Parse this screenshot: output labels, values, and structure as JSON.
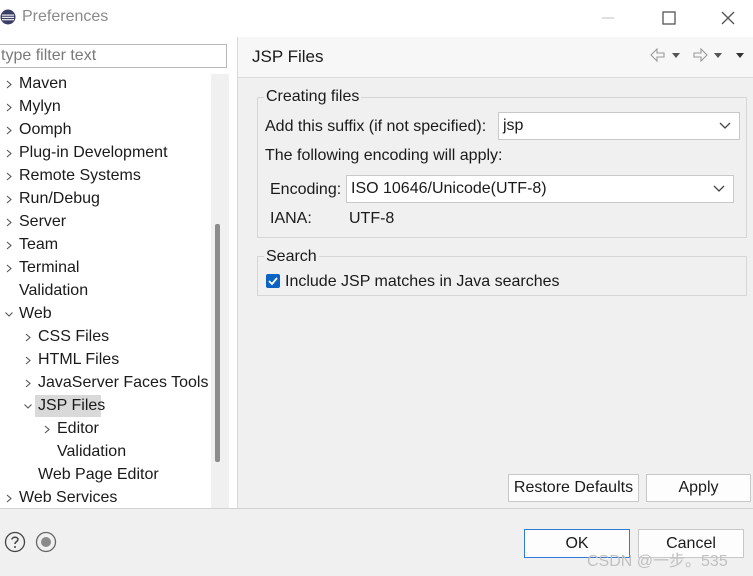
{
  "window": {
    "title": "Preferences"
  },
  "filter": {
    "placeholder": "type filter text"
  },
  "tree": {
    "items": [
      {
        "label": "Maven",
        "expander": "collapsed"
      },
      {
        "label": "Mylyn",
        "expander": "collapsed"
      },
      {
        "label": "Oomph",
        "expander": "collapsed"
      },
      {
        "label": "Plug-in Development",
        "expander": "collapsed"
      },
      {
        "label": "Remote Systems",
        "expander": "collapsed"
      },
      {
        "label": "Run/Debug",
        "expander": "collapsed"
      },
      {
        "label": "Server",
        "expander": "collapsed"
      },
      {
        "label": "Team",
        "expander": "collapsed"
      },
      {
        "label": "Terminal",
        "expander": "collapsed"
      },
      {
        "label": "Validation",
        "expander": "none"
      },
      {
        "label": "Web",
        "expander": "expanded"
      },
      {
        "label": "CSS Files",
        "expander": "collapsed"
      },
      {
        "label": "HTML Files",
        "expander": "collapsed"
      },
      {
        "label": "JavaServer Faces Tools",
        "expander": "collapsed"
      },
      {
        "label": "JSP Files",
        "expander": "expanded",
        "selected": true
      },
      {
        "label": "Editor",
        "expander": "collapsed"
      },
      {
        "label": "Validation",
        "expander": "none"
      },
      {
        "label": "Web Page Editor",
        "expander": "none"
      },
      {
        "label": "Web Services",
        "expander": "collapsed"
      }
    ]
  },
  "page": {
    "title": "JSP Files",
    "creating_files": {
      "legend": "Creating files",
      "suffix_label": "Add this suffix (if not specified):",
      "suffix_value": "jsp",
      "encoding_note": "The following encoding will apply:",
      "encoding_label": "Encoding:",
      "encoding_value": "ISO 10646/Unicode(UTF-8)",
      "iana_label": "IANA:",
      "iana_value": "UTF-8"
    },
    "search": {
      "legend": "Search",
      "include_label": "Include JSP matches in Java searches",
      "include_checked": true
    },
    "restore_label": "Restore Defaults",
    "apply_label": "Apply"
  },
  "footer": {
    "ok_label": "OK",
    "cancel_label": "Cancel"
  },
  "watermark": "CSDN @一步。535",
  "colors": {
    "accent": "#0b63c3",
    "selection": "#d9d9d9",
    "pane_bg": "#f0f0f0"
  },
  "icons": [
    "app-icon",
    "minimize-icon",
    "maximize-icon",
    "close-icon",
    "back-icon",
    "forward-icon",
    "menu-icon",
    "help-icon",
    "import-export-icon"
  ]
}
